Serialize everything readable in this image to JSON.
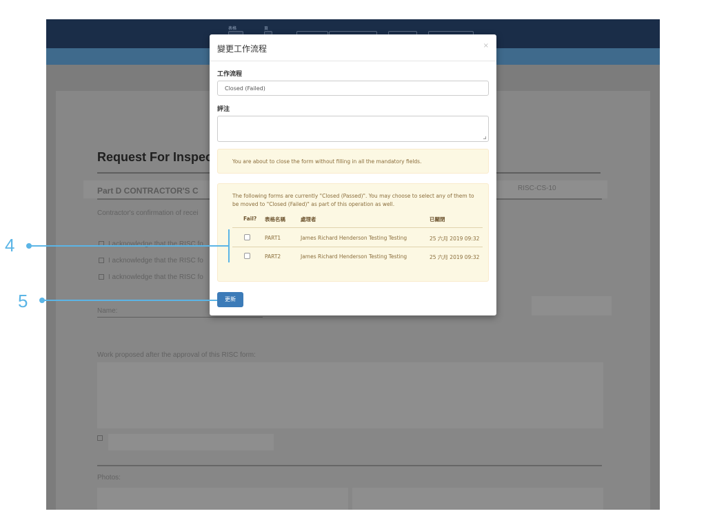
{
  "topbar": {
    "label_1": "表格",
    "label_2": "頁"
  },
  "background_form": {
    "title": "Request For Inspect",
    "section": "Part D    CONTRACTOR'S C",
    "confirmation_text": "Contractor's confirmation of recei",
    "ack_1": "I acknowledge that the RISC fo",
    "ack_2": "I acknowledge that the RISC fo",
    "ack_3": "I acknowledge that the RISC fo",
    "name_label": "Name:",
    "form_code": "RISC-CS-10",
    "work_proposed": "Work proposed after the approval of this RISC form:",
    "photos_label": "Photos:"
  },
  "modal": {
    "title": "變更工作流程",
    "close": "×",
    "workflow_label": "工作流程",
    "workflow_value": "Closed (Failed)",
    "remarks_label": "評注",
    "remarks_value": "",
    "warning": "You are about to close the form without filling in all the mandatory fields.",
    "note": "The following forms are currently \"Closed (Passed)\". You may choose to select any of them to be moved to \"Closed (Failed)\" as part of this operation as well.",
    "table": {
      "headers": [
        "Fail?",
        "表格名稱",
        "處理者",
        "已關閉"
      ],
      "rows": [
        {
          "form": "PART1",
          "handler": "James Richard Henderson Testing Testing",
          "closed": "25 六月 2019 09:32"
        },
        {
          "form": "PART2",
          "handler": "James Richard Henderson Testing Testing",
          "closed": "25 六月 2019 09:32"
        }
      ]
    },
    "update_button": "更新"
  },
  "callouts": {
    "four": "4",
    "five": "5"
  },
  "colors": {
    "callout": "#5bb5e6",
    "primary_button": "#3c7bb8",
    "warning_bg": "#fcf8e3"
  }
}
